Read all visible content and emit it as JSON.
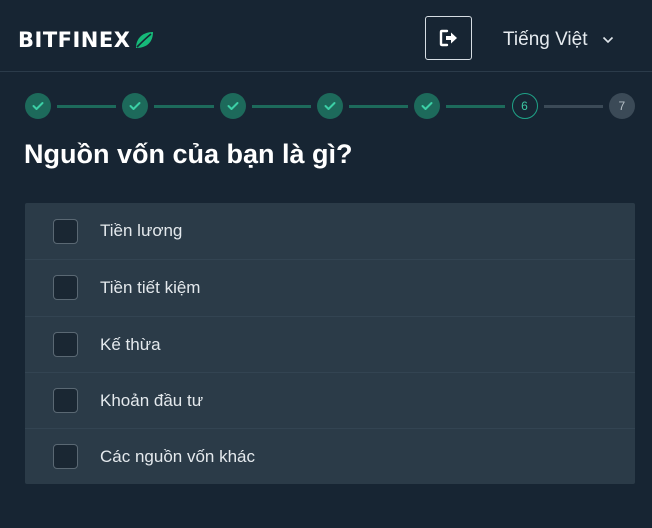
{
  "header": {
    "logo_text": "BITFINEX",
    "logout_icon": "sign-out-icon",
    "language": {
      "label": "Tiếng Việt",
      "icon": "chevron-down-icon"
    }
  },
  "stepper": {
    "steps": [
      {
        "status": "done",
        "label": ""
      },
      {
        "status": "done",
        "label": ""
      },
      {
        "status": "done",
        "label": ""
      },
      {
        "status": "done",
        "label": ""
      },
      {
        "status": "done",
        "label": ""
      },
      {
        "status": "current",
        "label": "6"
      },
      {
        "status": "future",
        "label": "7"
      }
    ],
    "colors": {
      "done": "#1d6a5b",
      "current": "#1fa287",
      "future": "#3b4a57"
    }
  },
  "question": {
    "title": "Nguồn vốn của bạn là gì?",
    "options": [
      {
        "label": "Tiền lương",
        "checked": false
      },
      {
        "label": "Tiền tiết kiệm",
        "checked": false
      },
      {
        "label": "Kế thừa",
        "checked": false
      },
      {
        "label": "Khoản đầu tư",
        "checked": false
      },
      {
        "label": "Các nguồn vốn khác",
        "checked": false
      }
    ]
  },
  "colors": {
    "background": "#172533",
    "panel": "#2b3b48",
    "accent": "#1fa287"
  }
}
